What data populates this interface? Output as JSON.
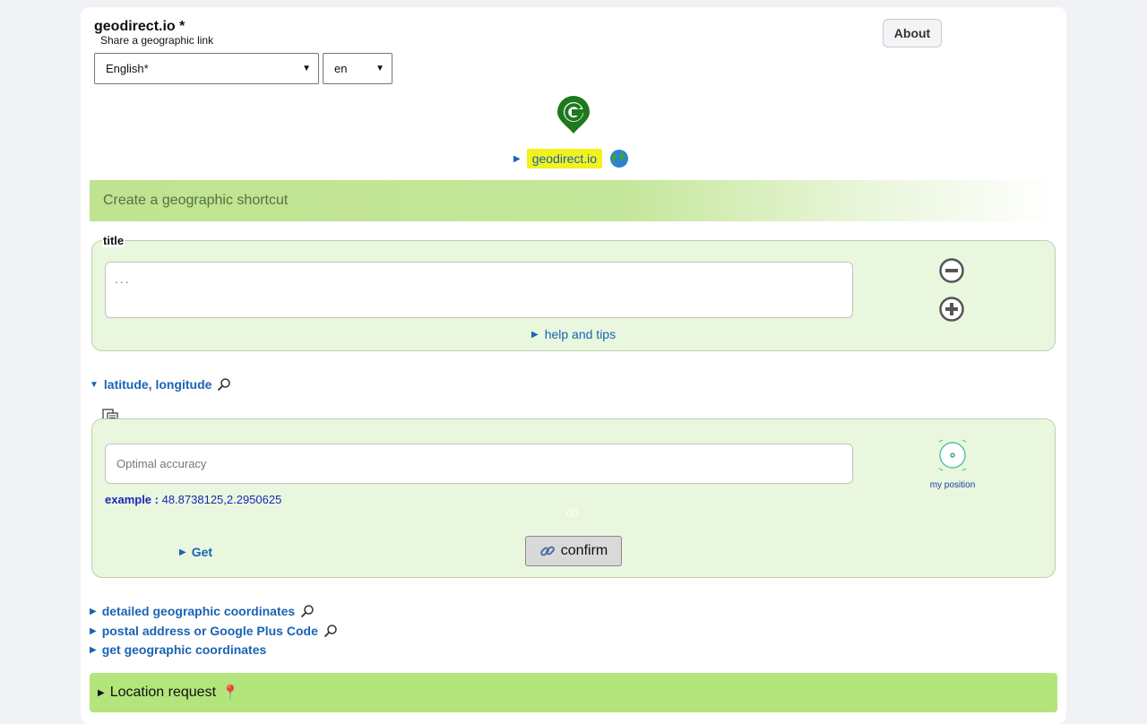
{
  "header": {
    "title": "geodirect.io *",
    "subtitle": "Share a geographic link",
    "about_label": "About"
  },
  "language": {
    "selected": "English*",
    "code": "en"
  },
  "home_link": "geodirect.io",
  "banner_title": "Create a geographic shortcut",
  "title_section": {
    "legend": "title",
    "placeholder": "...",
    "help_label": "help and tips"
  },
  "coords_section": {
    "toggle_label": "latitude, longitude",
    "placeholder": "Optimal accuracy",
    "my_position_label": "my position",
    "example_label": "example :",
    "example_value": "48.8738125,2.2950625",
    "status": "00",
    "get_label": "Get",
    "confirm_label": "confirm"
  },
  "more_links": [
    "detailed geographic coordinates",
    "postal address or Google Plus Code",
    "get geographic coordinates"
  ],
  "location_request_label": "Location request",
  "colors": {
    "accent_link": "#1a63b5",
    "panel_bg": "#e9f7df",
    "banner_green": "#bfe38f",
    "request_bar": "#b3e57c",
    "highlight": "#f2f21e"
  },
  "icons": [
    "logo-icon",
    "globe-icon",
    "minus-circle-icon",
    "plus-circle-icon",
    "search-icon",
    "copy-icon",
    "target-icon",
    "link-icon",
    "pin-icon"
  ]
}
